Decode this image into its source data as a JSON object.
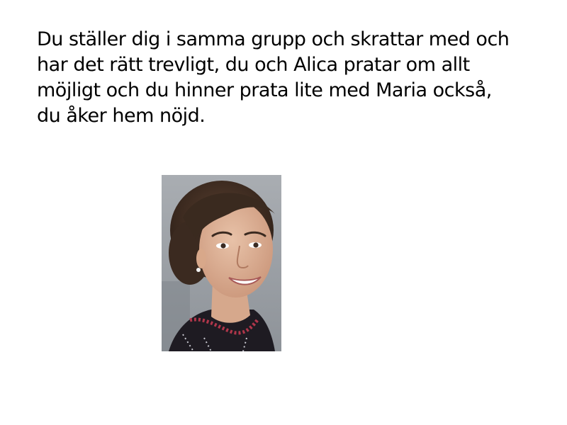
{
  "slide": {
    "lines": [
      "Du ställer dig i samma grupp och skrattar med och",
      "har det rätt trevligt, du och Alica pratar om allt",
      "möjligt och du hinner prata lite med Maria också,",
      "du åker hem nöjd."
    ]
  },
  "photo": {
    "subject": "portrait-of-smiling-woman",
    "background_color": "#9c9fa4"
  }
}
